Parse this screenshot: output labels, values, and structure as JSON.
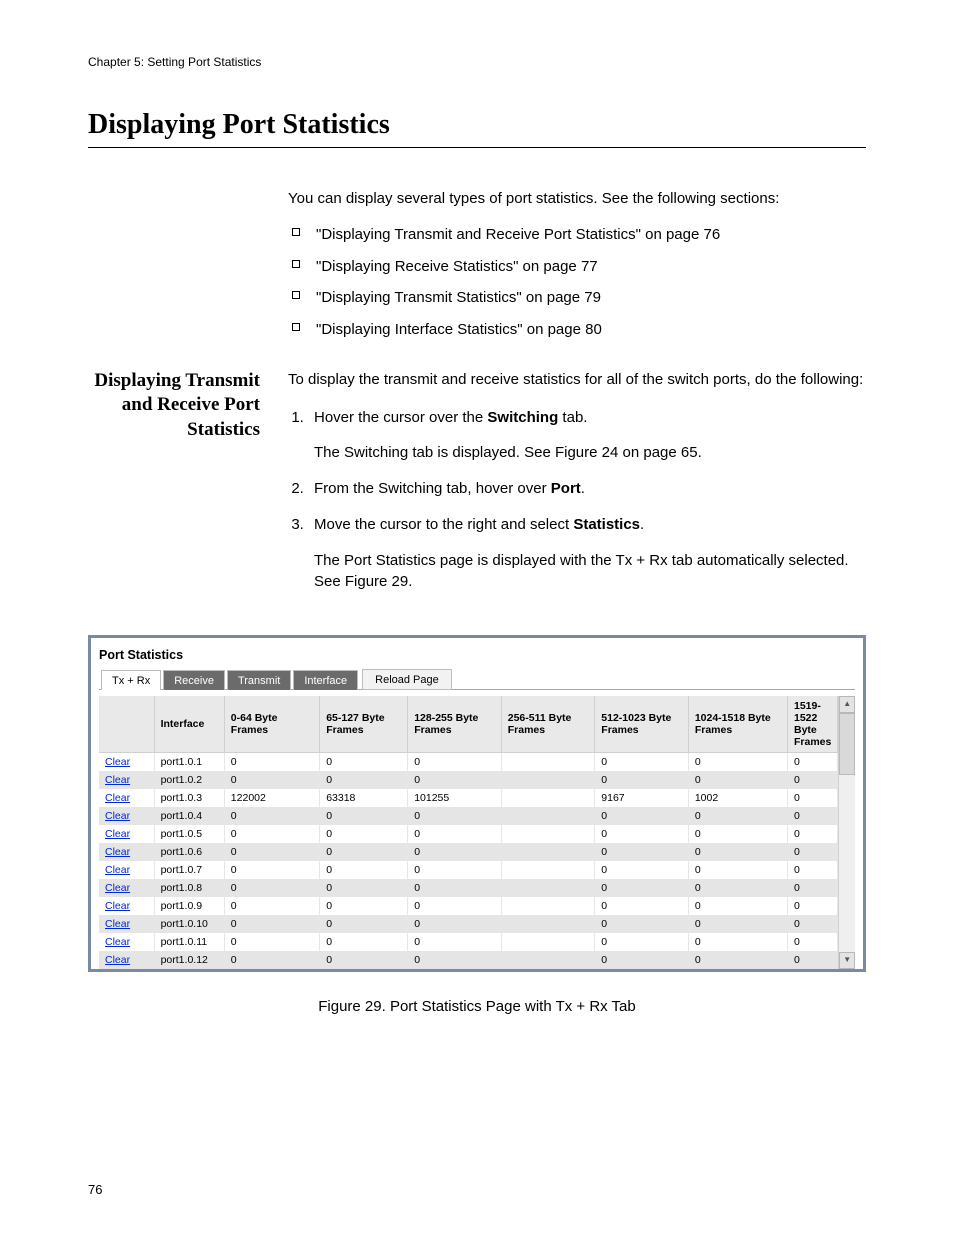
{
  "header": {
    "running_head": "Chapter 5: Setting Port Statistics",
    "title": "Displaying Port Statistics"
  },
  "intro": {
    "lead": "You can display several types of port statistics. See the following sections:",
    "bullets": [
      "\"Displaying Transmit and Receive Port Statistics\" on page 76",
      "\"Displaying Receive Statistics\" on page 77",
      "\"Displaying Transmit Statistics\" on page 79",
      "\"Displaying Interface Statistics\" on page 80"
    ]
  },
  "subsection": {
    "heading": "Displaying Transmit and Receive Port Statistics",
    "para": "To display the transmit and receive statistics for all of the switch ports, do the following:",
    "steps": {
      "s1_a": "Hover the cursor over the ",
      "s1_b": "Switching",
      "s1_c": " tab.",
      "s1_after": "The Switching tab is displayed. See Figure 24 on page 65.",
      "s2_a": "From the Switching tab, hover over ",
      "s2_b": "Port",
      "s2_c": ".",
      "s3_a": "Move the cursor to the right and select ",
      "s3_b": "Statistics",
      "s3_c": ".",
      "s3_after": "The Port Statistics page is displayed with the Tx + Rx tab automatically selected. See Figure 29."
    }
  },
  "panel": {
    "title": "Port Statistics",
    "tabs": {
      "txrx": "Tx + Rx",
      "receive": "Receive",
      "transmit": "Transmit",
      "interface": "Interface"
    },
    "reload": "Reload Page",
    "columns": {
      "c0": "",
      "c1": "Interface",
      "c2": "0-64 Byte Frames",
      "c3": "65-127 Byte Frames",
      "c4": "128-255 Byte Frames",
      "c5": "256-511 Byte Frames",
      "c6": "512-1023 Byte Frames",
      "c7": "1024-1518 Byte Frames",
      "c8": "1519-1522 Byte Frames"
    },
    "clear_label": "Clear",
    "rows": [
      {
        "iface": "port1.0.1",
        "v": [
          "0",
          "0",
          "0",
          "",
          "0",
          "0",
          "0"
        ]
      },
      {
        "iface": "port1.0.2",
        "v": [
          "0",
          "0",
          "0",
          "",
          "0",
          "0",
          "0"
        ]
      },
      {
        "iface": "port1.0.3",
        "v": [
          "122002",
          "63318",
          "101255",
          "",
          "9167",
          "1002",
          "0"
        ]
      },
      {
        "iface": "port1.0.4",
        "v": [
          "0",
          "0",
          "0",
          "",
          "0",
          "0",
          "0"
        ]
      },
      {
        "iface": "port1.0.5",
        "v": [
          "0",
          "0",
          "0",
          "",
          "0",
          "0",
          "0"
        ]
      },
      {
        "iface": "port1.0.6",
        "v": [
          "0",
          "0",
          "0",
          "",
          "0",
          "0",
          "0"
        ]
      },
      {
        "iface": "port1.0.7",
        "v": [
          "0",
          "0",
          "0",
          "",
          "0",
          "0",
          "0"
        ]
      },
      {
        "iface": "port1.0.8",
        "v": [
          "0",
          "0",
          "0",
          "",
          "0",
          "0",
          "0"
        ]
      },
      {
        "iface": "port1.0.9",
        "v": [
          "0",
          "0",
          "0",
          "",
          "0",
          "0",
          "0"
        ]
      },
      {
        "iface": "port1.0.10",
        "v": [
          "0",
          "0",
          "0",
          "",
          "0",
          "0",
          "0"
        ]
      },
      {
        "iface": "port1.0.11",
        "v": [
          "0",
          "0",
          "0",
          "",
          "0",
          "0",
          "0"
        ]
      },
      {
        "iface": "port1.0.12",
        "v": [
          "0",
          "0",
          "0",
          "",
          "0",
          "0",
          "0"
        ]
      }
    ]
  },
  "figure_caption": "Figure 29. Port Statistics Page with Tx + Rx Tab",
  "page_number": "76"
}
